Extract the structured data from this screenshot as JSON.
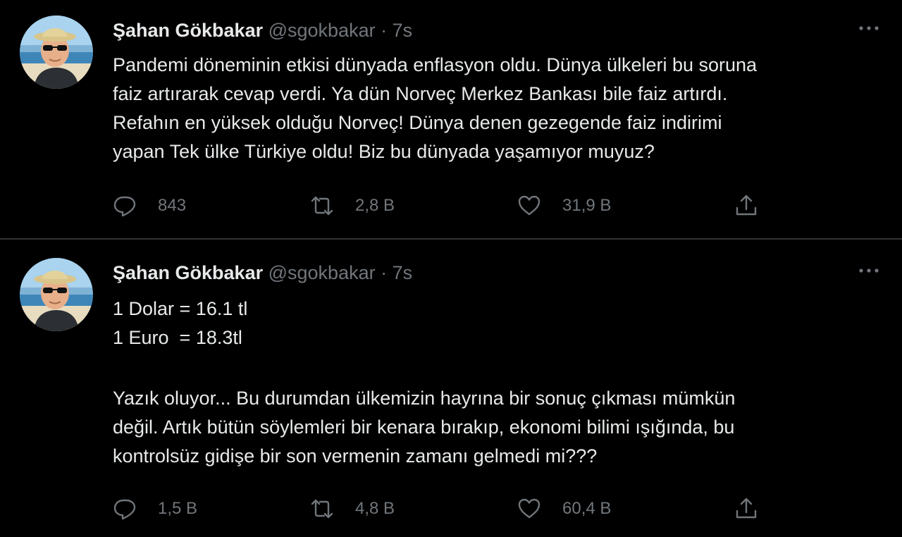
{
  "colors": {
    "background": "#000000",
    "text_primary": "#e7e9ea",
    "text_secondary": "#71767b",
    "divider": "#2f3336"
  },
  "icons": {
    "reply": "speech-bubble-icon",
    "retweet": "retweet-arrows-icon",
    "like": "heart-icon",
    "share": "share-upload-icon",
    "more": "three-dots-icon"
  },
  "tweets": [
    {
      "author_name": "Şahan Gökbakar",
      "handle": "@sgokbakar",
      "separator": "·",
      "time": "7s",
      "lines": [
        "Pandemi döneminin etkisi dünyada enflasyon oldu. Dünya ülkeleri bu soruna",
        "faiz artırarak cevap verdi. Ya dün Norveç Merkez Bankası bile faiz artırdı.",
        "Refahın en yüksek olduğu Norveç! Dünya denen gezegende faiz indirimi",
        "yapan Tek ülke Türkiye oldu! Biz bu dünyada yaşamıyor muyuz?"
      ],
      "replies": "843",
      "retweets": "2,8 B",
      "likes": "31,9 B"
    },
    {
      "author_name": "Şahan Gökbakar",
      "handle": "@sgokbakar",
      "separator": "·",
      "time": "7s",
      "lines_top": [
        "1 Dolar = 16.1 tl",
        "1 Euro  = 18.3tl"
      ],
      "lines_bottom": [
        "Yazık oluyor... Bu durumdan ülkemizin hayrına bir sonuç çıkması mümkün",
        "değil. Artık bütün söylemleri bir kenara bırakıp, ekonomi bilimi ışığında, bu",
        "kontrolsüz gidişe bir son vermenin zamanı gelmedi mi???"
      ],
      "replies": "1,5 B",
      "retweets": "4,8 B",
      "likes": "60,4 B"
    }
  ]
}
